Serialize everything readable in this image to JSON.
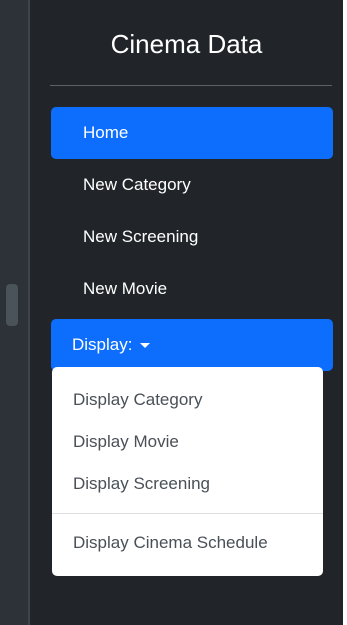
{
  "sidebar": {
    "brand": "Cinema Data",
    "nav": [
      {
        "label": "Home",
        "active": true
      },
      {
        "label": "New Category",
        "active": false
      },
      {
        "label": "New Screening",
        "active": false
      },
      {
        "label": "New Movie",
        "active": false
      }
    ],
    "dropdown": {
      "label": "Display:",
      "expanded": true,
      "items": [
        {
          "label": "Display Category"
        },
        {
          "label": "Display Movie"
        },
        {
          "label": "Display Screening"
        }
      ],
      "footer_item": {
        "label": "Display Cinema Schedule"
      }
    }
  },
  "colors": {
    "sidebar_bg": "#212529",
    "accent": "#0d6efd",
    "menu_text": "#495057"
  }
}
